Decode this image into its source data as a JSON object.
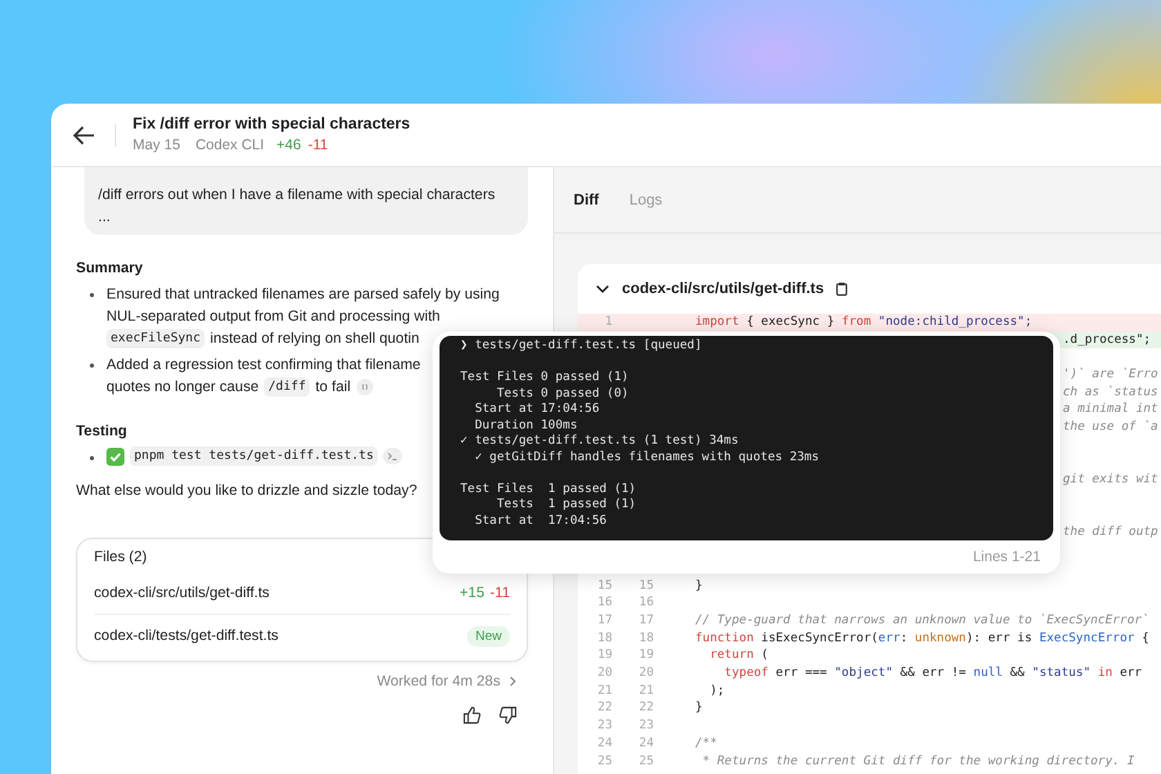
{
  "header": {
    "title": "Fix /diff error with special characters",
    "date": "May 15",
    "source": "Codex CLI",
    "additions": "+46",
    "deletions": "-11"
  },
  "user_message": {
    "text": "/diff errors out when I have a filename with special characters",
    "more": "..."
  },
  "summary": {
    "heading": "Summary",
    "bullets": [
      [
        [
          {
            "kind": "text",
            "text": "Ensured that untracked filenames are parsed safely by using"
          }
        ],
        [
          {
            "kind": "text",
            "text": "NUL-separated output from Git and processing with"
          }
        ],
        [
          {
            "kind": "code",
            "text": "execFileSync"
          },
          {
            "kind": "text",
            "text": "instead of relying on shell quotin"
          }
        ]
      ],
      [
        [
          {
            "kind": "text",
            "text": "Added a regression test confirming that filename"
          }
        ],
        [
          {
            "kind": "text",
            "text": "quotes no longer cause"
          },
          {
            "kind": "code",
            "text": "/diff"
          },
          {
            "kind": "text",
            "text": "to fail"
          },
          {
            "kind": "ref"
          }
        ]
      ]
    ]
  },
  "testing": {
    "heading": "Testing",
    "passed": true,
    "command": "pnpm test tests/get-diff.test.ts"
  },
  "prompt": "What else would you like to drizzle and sizzle today?",
  "files": {
    "title": "Files (2)",
    "rows": [
      {
        "path": "codex-cli/src/utils/get-diff.ts",
        "kind": "diff",
        "additions": "+15",
        "deletions": "-11"
      },
      {
        "path": "codex-cli/tests/get-diff.test.ts",
        "kind": "new",
        "badge": "New"
      }
    ]
  },
  "worked": "Worked for 4m 28s",
  "tabs": [
    {
      "label": "Diff",
      "selected": true
    },
    {
      "label": "Logs",
      "selected": false
    }
  ],
  "diff_file": {
    "path": "codex-cli/src/utils/get-diff.ts",
    "expanded": true,
    "lines": [
      {
        "kind": "removed",
        "old": "1",
        "code": [
          {
            "kind": "kw",
            "s": "import"
          },
          {
            "kind": "pl",
            "s": " { execSync } "
          },
          {
            "kind": "kw",
            "s": "from"
          },
          {
            "kind": "str",
            "s": " \"node:child_process\";"
          }
        ]
      },
      {
        "kind": "covered-added",
        "code": [
          {
            "kind": "pl",
            "s": ".d_process\";"
          }
        ]
      },
      {
        "kind": "covered"
      },
      {
        "kind": "covered",
        "code": [
          {
            "kind": "cm",
            "s": "')` are `Erro"
          }
        ]
      },
      {
        "kind": "covered",
        "code": [
          {
            "kind": "cm",
            "s": "ch as `status"
          }
        ]
      },
      {
        "kind": "covered",
        "code": [
          {
            "kind": "cm",
            "s": "a minimal int"
          }
        ]
      },
      {
        "kind": "covered",
        "code": [
          {
            "kind": "cm",
            "s": "the use of `a"
          }
        ]
      },
      {
        "kind": "covered"
      },
      {
        "kind": "covered"
      },
      {
        "kind": "covered",
        "code": [
          {
            "kind": "cm",
            "s": "git exits wit"
          }
        ]
      },
      {
        "kind": "covered"
      },
      {
        "kind": "covered"
      },
      {
        "kind": "covered",
        "code": [
          {
            "kind": "cm",
            "s": "the diff outp"
          }
        ]
      },
      {
        "kind": "covered"
      },
      {
        "kind": "context",
        "old": "15",
        "new": "15",
        "code": [
          {
            "kind": "pl",
            "s": "}"
          }
        ]
      },
      {
        "kind": "context",
        "old": "16",
        "new": "16"
      },
      {
        "kind": "context",
        "old": "17",
        "new": "17",
        "code": [
          {
            "kind": "cm",
            "s": "// Type-guard that narrows an unknown value to `ExecSyncError`"
          }
        ]
      },
      {
        "kind": "context",
        "old": "18",
        "new": "18",
        "code": [
          {
            "kind": "kw",
            "s": "function"
          },
          {
            "kind": "pl",
            "s": " isExecSyncError("
          },
          {
            "kind": "ty",
            "s": "err"
          },
          {
            "kind": "pl",
            "s": ": "
          },
          {
            "kind": "or",
            "s": "unknown"
          },
          {
            "kind": "pl",
            "s": "): err is "
          },
          {
            "kind": "ty",
            "s": "ExecSyncError"
          },
          {
            "kind": "pl",
            "s": " {"
          }
        ]
      },
      {
        "kind": "context",
        "old": "19",
        "new": "19",
        "code": [
          {
            "kind": "kw",
            "s": "  return"
          },
          {
            "kind": "pl",
            "s": " ("
          }
        ]
      },
      {
        "kind": "context",
        "old": "20",
        "new": "20",
        "code": [
          {
            "kind": "kw",
            "s": "    typeof"
          },
          {
            "kind": "pl",
            "s": " err === "
          },
          {
            "kind": "str",
            "s": "\"object\""
          },
          {
            "kind": "pl",
            "s": " && err != "
          },
          {
            "kind": "ty",
            "s": "null"
          },
          {
            "kind": "pl",
            "s": " && "
          },
          {
            "kind": "str",
            "s": "\"status\""
          },
          {
            "kind": "kw",
            "s": " in"
          },
          {
            "kind": "pl",
            "s": " err"
          }
        ]
      },
      {
        "kind": "context",
        "old": "21",
        "new": "21",
        "code": [
          {
            "kind": "pl",
            "s": "  );"
          }
        ]
      },
      {
        "kind": "context",
        "old": "22",
        "new": "22",
        "code": [
          {
            "kind": "pl",
            "s": "}"
          }
        ]
      },
      {
        "kind": "context",
        "old": "23",
        "new": "23"
      },
      {
        "kind": "context",
        "old": "24",
        "new": "24",
        "code": [
          {
            "kind": "cm",
            "s": "/**"
          }
        ]
      },
      {
        "kind": "context",
        "old": "25",
        "new": "25",
        "code": [
          {
            "kind": "cm",
            "s": " * Returns the current Git diff for the working directory. I"
          }
        ]
      }
    ]
  },
  "terminal": {
    "blocks": [
      [
        "❯ tests/get-diff.test.ts [queued]"
      ],
      [
        "Test Files 0 passed (1)",
        "     Tests 0 passed (0)",
        "  Start at 17:04:56",
        "  Duration 100ms",
        "✓ tests/get-diff.test.ts (1 test) 34ms",
        "  ✓ getGitDiff handles filenames with quotes 23ms"
      ],
      [
        "Test Files  1 passed (1)",
        "     Tests  1 passed (1)",
        "  Start at  17:04:56"
      ]
    ],
    "footer": "Lines 1-21"
  }
}
